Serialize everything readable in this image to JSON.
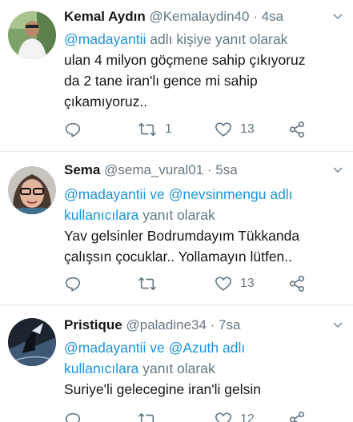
{
  "tweets": [
    {
      "display_name": "Kemal Aydın",
      "handle": "@Kemalaydin40",
      "time": "· 4sa",
      "reply_mentions": "@madayantii",
      "reply_suffix": " adlı kişiye yanıt olarak",
      "body_lines": [
        "ulan 4 milyon göçmene sahip çıkıyoruz",
        "da 2 tane iran'lı gence mi sahip",
        "çıkamıyoruz.."
      ],
      "retweets": "1",
      "likes": "13"
    },
    {
      "display_name": "Sema",
      "handle": "@sema_vural01",
      "time": "· 5sa",
      "reply_line1_mention_a": "@madayantii",
      "reply_line1_ve": " ve ",
      "reply_line1_mention_b": "@nevsinmengu",
      "reply_line1_suffix": " adlı",
      "reply_line2_link": "kullanıcılara",
      "reply_line2_suffix": " yanıt olarak",
      "body_lines": [
        "Yav gelsinler Bodrumdayım Tükkanda",
        "çalışsın çocuklar.. Yollamayın lütfen.."
      ],
      "retweets": "",
      "likes": "13"
    },
    {
      "display_name": "Pristique",
      "handle": "@paladine34",
      "time": "· 7sa",
      "reply_line1_mention_a": "@madayantii",
      "reply_line1_ve": " ve ",
      "reply_line1_mention_b": "@Azuth",
      "reply_line1_suffix": " adlı",
      "reply_line2_link": "kullanıcılara",
      "reply_line2_suffix": " yanıt olarak",
      "body_lines": [
        "Suriye'li gelecegine iran'li gelsin"
      ],
      "retweets": "",
      "likes": "12"
    }
  ],
  "colors": {
    "link": "#1b95e0",
    "muted": "#657786",
    "text": "#14171a",
    "divider": "#e1e8ed"
  },
  "icons": [
    "reply-icon",
    "retweet-icon",
    "like-icon",
    "share-icon",
    "chevron-down-icon"
  ]
}
